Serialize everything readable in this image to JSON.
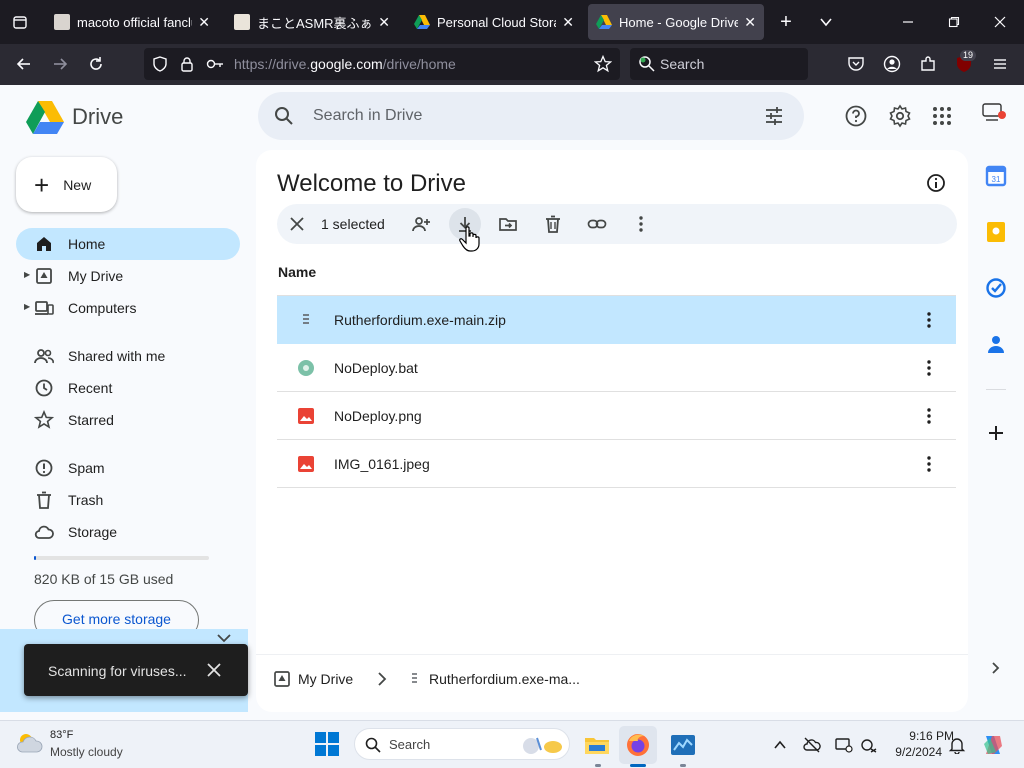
{
  "browser": {
    "tabs": [
      {
        "title": "macoto official fanclub",
        "active": false
      },
      {
        "title": "まことASMR裏ふぁんく",
        "active": false
      },
      {
        "title": "Personal Cloud Storage",
        "active": false
      },
      {
        "title": "Home - Google Drive",
        "active": true
      }
    ],
    "url_prefix": "https://drive.",
    "url_domain": "google.com",
    "url_path": "/drive/home",
    "search_placeholder": "Search",
    "extension_badge": "19"
  },
  "drive": {
    "app_name": "Drive",
    "search_placeholder": "Search in Drive",
    "new_label": "New",
    "nav": [
      {
        "label": "Home",
        "icon": "home-icon",
        "active": true
      },
      {
        "label": "My Drive",
        "icon": "my-drive-icon",
        "active": false
      },
      {
        "label": "Computers",
        "icon": "computers-icon",
        "active": false
      },
      {
        "label": "Shared with me",
        "icon": "shared-icon",
        "active": false
      },
      {
        "label": "Recent",
        "icon": "clock-icon",
        "active": false
      },
      {
        "label": "Starred",
        "icon": "star-icon",
        "active": false
      },
      {
        "label": "Spam",
        "icon": "spam-icon",
        "active": false
      },
      {
        "label": "Trash",
        "icon": "trash-icon",
        "active": false
      },
      {
        "label": "Storage",
        "icon": "cloud-icon",
        "active": false
      }
    ],
    "storage_used_text": "820 KB of 15 GB used",
    "storage_fraction": 0.0001,
    "get_storage_label": "Get more storage",
    "toast_message": "Scanning for viruses...",
    "page_title": "Welcome to Drive",
    "selection_count": "1 selected",
    "column_name": "Name",
    "files": [
      {
        "name": "Rutherfordium.exe-main.zip",
        "type": "zip",
        "selected": true
      },
      {
        "name": "NoDeploy.bat",
        "type": "bat",
        "selected": false
      },
      {
        "name": "NoDeploy.png",
        "type": "image",
        "selected": false
      },
      {
        "name": "IMG_0161.jpeg",
        "type": "image",
        "selected": false
      }
    ],
    "breadcrumb": {
      "root": "My Drive",
      "current": "Rutherfordium.exe-ma..."
    }
  },
  "taskbar": {
    "temperature": "83°F",
    "weather": "Mostly cloudy",
    "search_placeholder": "Search",
    "time": "9:16 PM",
    "date": "9/2/2024"
  },
  "colors": {
    "accent": "#0b57d0",
    "selected_bg": "#c2e7ff",
    "browser_dark": "#1c1b22"
  }
}
